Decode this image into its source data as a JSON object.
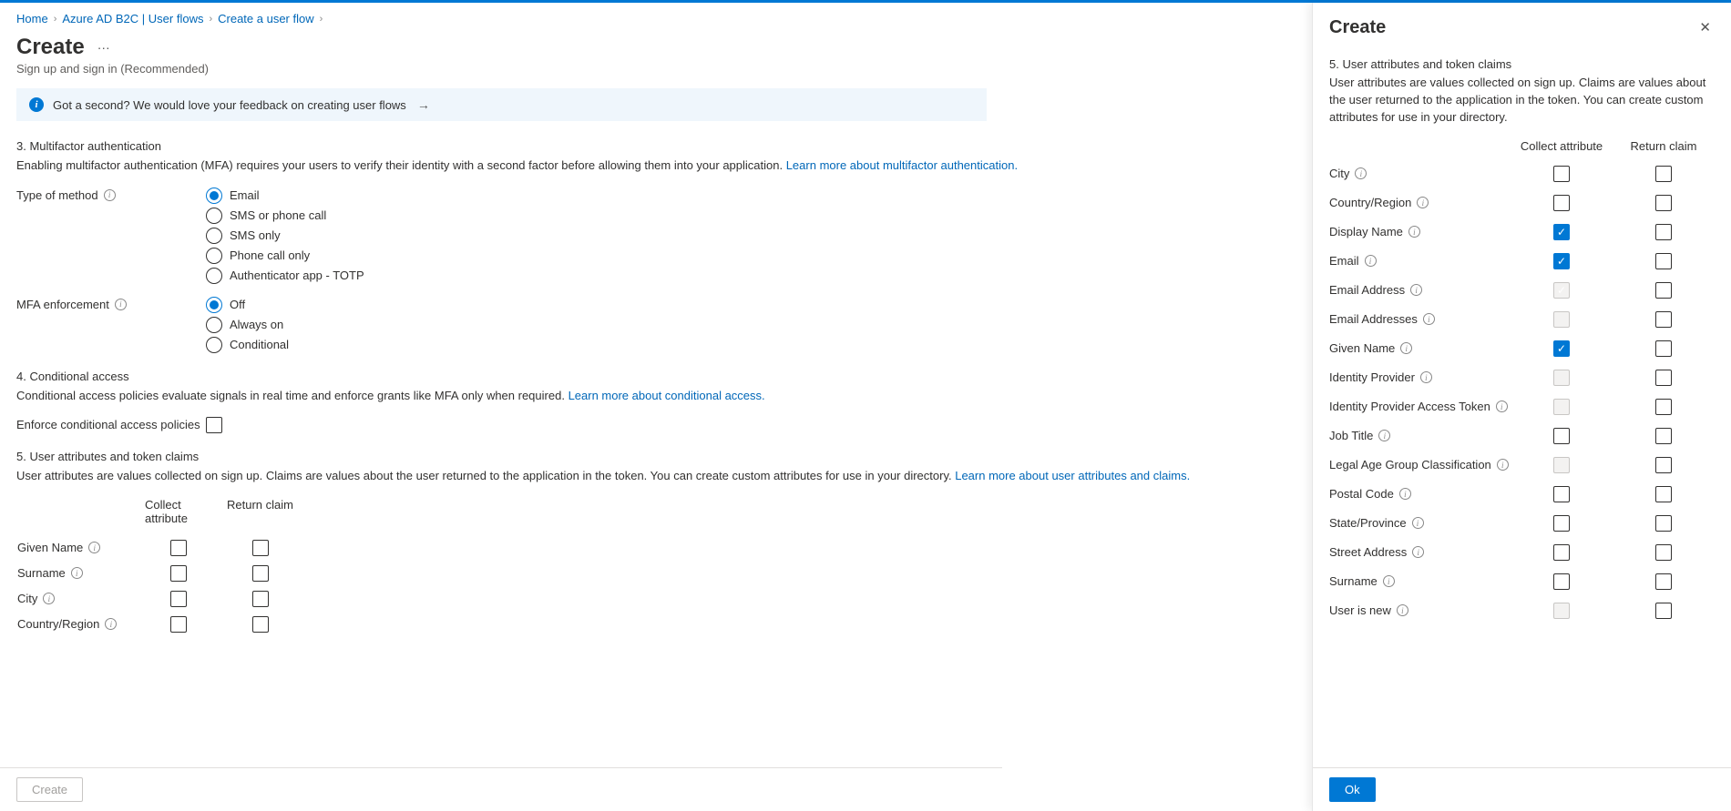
{
  "breadcrumb": {
    "home": "Home",
    "b2c": "Azure AD B2C | User flows",
    "create_uf": "Create a user flow"
  },
  "page": {
    "title": "Create",
    "subtitle": "Sign up and sign in (Recommended)",
    "banner_text": "Got a second? We would love your feedback on creating user flows"
  },
  "section3": {
    "title": "3. Multifactor authentication",
    "desc1": "Enabling multifactor authentication (MFA) requires your users to verify their identity with a second factor before allowing them into your application. ",
    "link": "Learn more about multifactor authentication.",
    "type_label": "Type of method",
    "type_options": {
      "email": "Email",
      "sms_phone": "SMS or phone call",
      "sms_only": "SMS only",
      "phone_only": "Phone call only",
      "totp": "Authenticator app - TOTP"
    },
    "enforcement_label": "MFA enforcement",
    "enforcement_options": {
      "off": "Off",
      "always": "Always on",
      "conditional": "Conditional"
    }
  },
  "section4": {
    "title": "4. Conditional access",
    "desc1": "Conditional access policies evaluate signals in real time and enforce grants like MFA only when required. ",
    "link": "Learn more about conditional access.",
    "checkbox_label": "Enforce conditional access policies"
  },
  "section5": {
    "title": "5. User attributes and token claims",
    "desc1": "User attributes are values collected on sign up. Claims are values about the user returned to the application in the token. You can create custom attributes for use in your directory. ",
    "link": "Learn more about user attributes and claims.",
    "col_collect": "Collect attribute",
    "col_return": "Return claim",
    "rows": [
      {
        "name": "Given Name"
      },
      {
        "name": "Surname"
      },
      {
        "name": "City"
      },
      {
        "name": "Country/Region"
      }
    ]
  },
  "footer": {
    "create": "Create"
  },
  "panel": {
    "title": "Create",
    "p_title": "5. User attributes and token claims",
    "p_desc": "User attributes are values collected on sign up. Claims are values about the user returned to the application in the token. You can create custom attributes for use in your directory.",
    "col_collect": "Collect attribute",
    "col_return": "Return claim",
    "ok": "Ok",
    "attrs": [
      {
        "name": "City",
        "collect": false,
        "return": false,
        "collect_disabled": false
      },
      {
        "name": "Country/Region",
        "collect": false,
        "return": false,
        "collect_disabled": false
      },
      {
        "name": "Display Name",
        "collect": true,
        "return": false,
        "collect_disabled": false
      },
      {
        "name": "Email",
        "collect": true,
        "return": false,
        "collect_disabled": false
      },
      {
        "name": "Email Address",
        "collect": true,
        "return": false,
        "collect_disabled": true
      },
      {
        "name": "Email Addresses",
        "collect": false,
        "return": false,
        "collect_disabled": true
      },
      {
        "name": "Given Name",
        "collect": true,
        "return": false,
        "collect_disabled": false
      },
      {
        "name": "Identity Provider",
        "collect": false,
        "return": false,
        "collect_disabled": true
      },
      {
        "name": "Identity Provider Access Token",
        "collect": false,
        "return": false,
        "collect_disabled": true
      },
      {
        "name": "Job Title",
        "collect": false,
        "return": false,
        "collect_disabled": false
      },
      {
        "name": "Legal Age Group Classification",
        "collect": false,
        "return": false,
        "collect_disabled": true
      },
      {
        "name": "Postal Code",
        "collect": false,
        "return": false,
        "collect_disabled": false
      },
      {
        "name": "State/Province",
        "collect": false,
        "return": false,
        "collect_disabled": false
      },
      {
        "name": "Street Address",
        "collect": false,
        "return": false,
        "collect_disabled": false
      },
      {
        "name": "Surname",
        "collect": false,
        "return": false,
        "collect_disabled": false
      },
      {
        "name": "User is new",
        "collect": false,
        "return": false,
        "collect_disabled": true
      }
    ]
  }
}
